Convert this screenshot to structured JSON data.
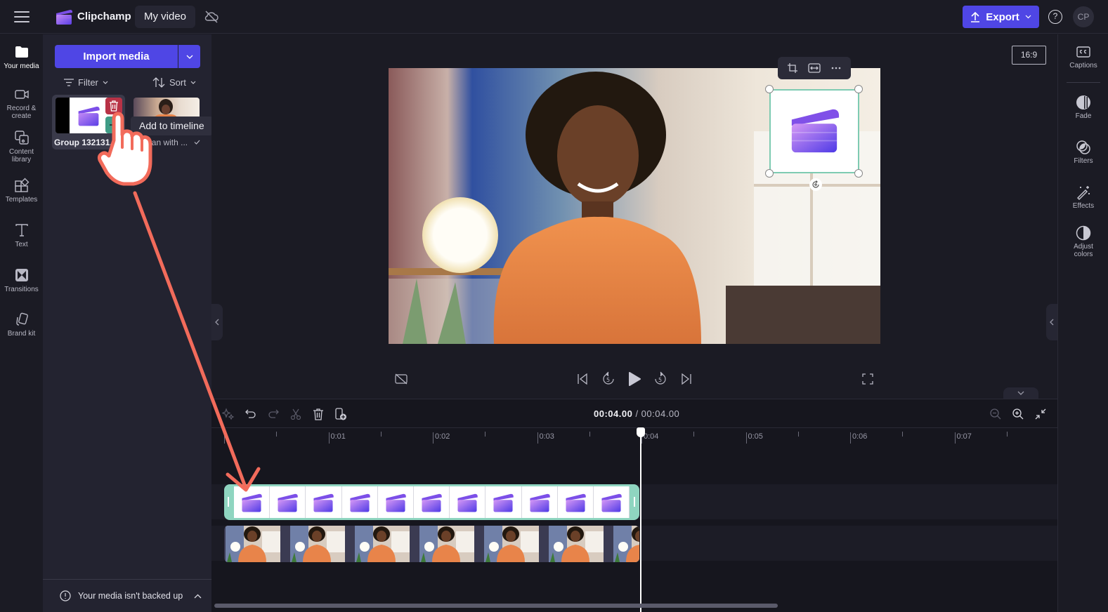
{
  "topbar": {
    "app_name": "Clipchamp",
    "project_name": "My video",
    "export_label": "Export",
    "help_label": "?",
    "avatar_initials": "CP"
  },
  "leftnav": {
    "items": [
      {
        "label": "Your media",
        "icon": "folder-icon",
        "active": true
      },
      {
        "label": "Record & create",
        "icon": "camera-icon"
      },
      {
        "label": "Content library",
        "icon": "content-library-icon"
      },
      {
        "label": "Templates",
        "icon": "templates-icon"
      },
      {
        "label": "Text",
        "icon": "text-icon"
      },
      {
        "label": "Transitions",
        "icon": "transitions-icon"
      },
      {
        "label": "Brand kit",
        "icon": "brand-kit-icon"
      }
    ]
  },
  "media": {
    "import_label": "Import media",
    "filter_label": "Filter",
    "sort_label": "Sort",
    "items": [
      {
        "name": "Group 132131...",
        "type": "image",
        "selected": true
      },
      {
        "name": "Woman with ...",
        "type": "video",
        "added": true
      }
    ],
    "tooltip": "Add to timeline",
    "backup_notice": "Your media isn't backed up"
  },
  "preview": {
    "aspect_ratio": "16:9",
    "object_toolbar": [
      "crop-icon",
      "fit-icon",
      "more-icon"
    ]
  },
  "playback": {
    "controls": [
      "captions-off-icon",
      "skip-back-icon",
      "rewind-5-icon",
      "play-icon",
      "forward-5-icon",
      "skip-forward-icon",
      "fullscreen-icon"
    ],
    "rewind_seconds": "5",
    "forward_seconds": "5"
  },
  "rightpanel": {
    "items": [
      {
        "label": "Captions",
        "icon": "captions-icon"
      },
      {
        "label": "Fade",
        "icon": "fade-icon"
      },
      {
        "label": "Filters",
        "icon": "filters-icon"
      },
      {
        "label": "Effects",
        "icon": "effects-icon"
      },
      {
        "label": "Adjust colors",
        "icon": "adjust-colors-icon"
      }
    ]
  },
  "timeline": {
    "current_time": "00:04.00",
    "separator": " / ",
    "total_time": "00:04.00",
    "ruler_labels": [
      "0:01",
      "0:02",
      "0:03",
      "0:04",
      "0:05",
      "0:06",
      "0:07"
    ],
    "playhead_seconds": 4,
    "overlay_clip_frames": 11,
    "video_clip_frames": 7
  },
  "colors": {
    "accent": "#4f46e5",
    "selection": "#7ecbb2",
    "delete": "#b83246",
    "add": "#3f9c86",
    "annotation": "#f26b5b"
  }
}
